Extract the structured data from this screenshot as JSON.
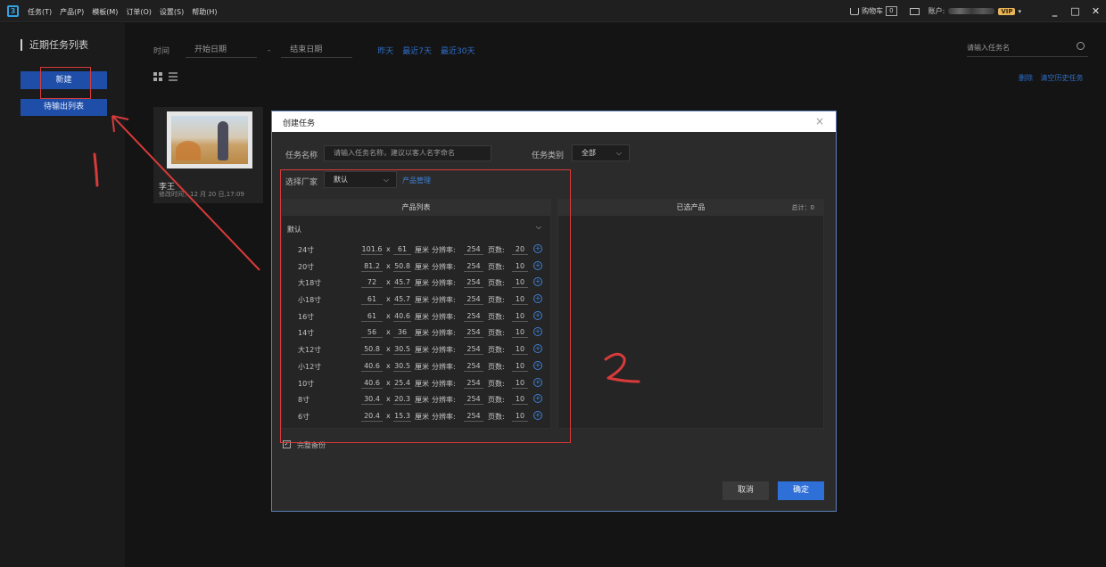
{
  "titlebar": {
    "menus": [
      "任务(T)",
      "产品(P)",
      "模板(M)",
      "订单(O)",
      "设置(S)",
      "帮助(H)"
    ],
    "cart_label": "购物车",
    "cart_count": "0",
    "account_label": "账户:",
    "vip_label": "VIP",
    "window_buttons": [
      "_",
      "□",
      "✕"
    ]
  },
  "sidebar": {
    "title": "近期任务列表",
    "new_button": "新建",
    "queue_button": "待输出列表"
  },
  "filter": {
    "time_label": "时间",
    "start_placeholder": "开始日期",
    "separator": "-",
    "end_placeholder": "结束日期",
    "quick_links": [
      "昨天",
      "最近7天",
      "最近30天"
    ],
    "search_placeholder": "请输入任务名"
  },
  "toolbar": {
    "delete_label": "删除",
    "clear_history_label": "清空历史任务"
  },
  "task_card": {
    "name": "李王",
    "modified": "修改时间：12 月 20 日,17:09"
  },
  "dialog": {
    "title": "创建任务",
    "close": "×",
    "task_name_label": "任务名称",
    "task_name_placeholder": "请输入任务名称，建议以客人名字命名",
    "task_type_label": "任务类别",
    "task_type_value": "全部",
    "vendor_label": "选择厂家",
    "vendor_value": "默认",
    "product_mgmt_link": "产品管理",
    "product_list_title": "产品列表",
    "selected_title": "已选产品",
    "selected_total": "总计：0",
    "group_name": "默认",
    "unit": "厘米",
    "x_sep": "x",
    "res_label": "分辨率:",
    "pages_label": "页数:",
    "products": [
      {
        "name": "24寸",
        "w": "101.6",
        "h": "61",
        "res": "254",
        "pages": "20"
      },
      {
        "name": "20寸",
        "w": "81.2",
        "h": "50.8",
        "res": "254",
        "pages": "10"
      },
      {
        "name": "大18寸",
        "w": "72",
        "h": "45.7",
        "res": "254",
        "pages": "10"
      },
      {
        "name": "小18寸",
        "w": "61",
        "h": "45.7",
        "res": "254",
        "pages": "10"
      },
      {
        "name": "16寸",
        "w": "61",
        "h": "40.6",
        "res": "254",
        "pages": "10"
      },
      {
        "name": "14寸",
        "w": "56",
        "h": "36",
        "res": "254",
        "pages": "10"
      },
      {
        "name": "大12寸",
        "w": "50.8",
        "h": "30.5",
        "res": "254",
        "pages": "10"
      },
      {
        "name": "小12寸",
        "w": "40.6",
        "h": "30.5",
        "res": "254",
        "pages": "10"
      },
      {
        "name": "10寸",
        "w": "40.6",
        "h": "25.4",
        "res": "254",
        "pages": "10"
      },
      {
        "name": "8寸",
        "w": "30.4",
        "h": "20.3",
        "res": "254",
        "pages": "10"
      },
      {
        "name": "6寸",
        "w": "20.4",
        "h": "15.3",
        "res": "254",
        "pages": "10"
      }
    ],
    "backup_label": "完整备份",
    "cancel_button": "取消",
    "ok_button": "确定"
  },
  "annotations": {
    "label_1": "1",
    "label_2": "2",
    "color": "#d93a3a"
  }
}
